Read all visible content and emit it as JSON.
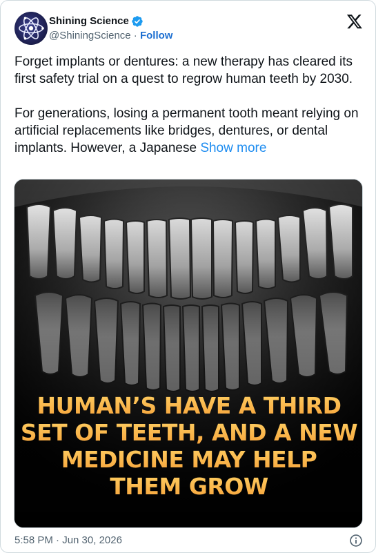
{
  "author": {
    "display_name": "Shining Science",
    "handle": "@ShiningScience",
    "separator": " · ",
    "follow_label": "Follow",
    "verified": true,
    "verified_color": "#1d9bf0"
  },
  "brand_icon": "x-logo-icon",
  "tweet": {
    "paragraph1": "Forget implants or dentures: a new therapy has cleared its first safety trial on a quest to regrow human teeth by 2030.",
    "paragraph2": "For generations, losing a permanent tooth meant relying on artificial replacements like bridges, dentures, or dental implants. However, a Japanese ",
    "show_more_label": "Show more",
    "link_color": "#1d9bf0"
  },
  "media": {
    "headline_lines": [
      "HUMAN’S HAVE A THIRD",
      "SET OF TEETH, AND A NEW",
      "MEDICINE MAY HELP",
      "THEM GROW"
    ],
    "headline_color": "#f6b04c"
  },
  "footer": {
    "timestamp": "5:58 PM · Jun 30, 2026",
    "info_icon": "info-icon"
  }
}
